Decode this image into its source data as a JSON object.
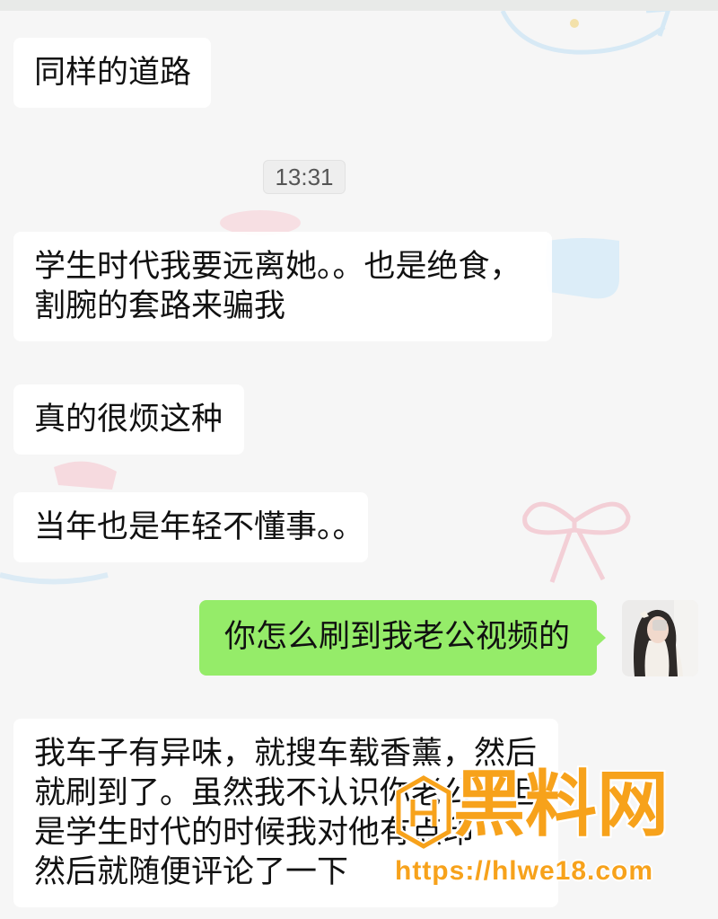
{
  "chat": {
    "timestamp": "13:31",
    "received": [
      {
        "lines": [
          "同样的道路"
        ]
      },
      {
        "lines": [
          "学生时代我要远离她。。也是绝食，",
          "割腕的套路来骗我"
        ]
      },
      {
        "lines": [
          "真的很烦这种"
        ]
      },
      {
        "lines": [
          "当年也是年轻不懂事。。"
        ]
      },
      {
        "lines": [
          "我车子有异味，就搜车载香薰，然后",
          "就刷到了。虽然我不认识你老公，但",
          "是学生时代的时候我对他有点印",
          "然后就随便评论了一下"
        ]
      }
    ],
    "sent": [
      {
        "lines": [
          "你怎么刷到我老公视频的"
        ]
      }
    ]
  },
  "watermark": {
    "brand": "黑料网",
    "url": "https://hlwe18.com"
  },
  "icons": {
    "avatar": "user-avatar",
    "watermark_logo": "watermark-logo-icon"
  },
  "colors": {
    "background": "#F6F6F6",
    "received_bubble": "#FFFFFF",
    "sent_bubble": "#95EC69",
    "timestamp_text": "#555555",
    "watermark": "#F7A21B"
  }
}
